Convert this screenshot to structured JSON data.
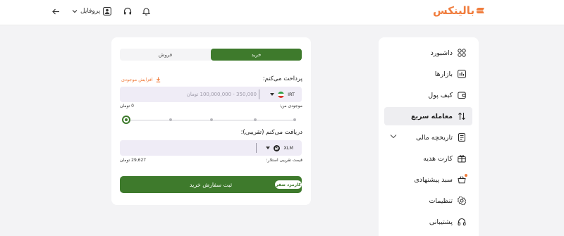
{
  "header": {
    "logo_text": "بالینکس",
    "profile_label": "پروفایل",
    "icons": [
      "bell-icon",
      "headset-icon",
      "user-icon",
      "chevron-down-icon",
      "arrow-left-icon"
    ]
  },
  "sidebar": {
    "items": [
      {
        "label": "داشبورد",
        "icon": "dashboard-icon"
      },
      {
        "label": "بازارها",
        "icon": "market-icon"
      },
      {
        "label": "کیف پول",
        "icon": "wallet-icon"
      },
      {
        "label": "معامله سریع",
        "icon": "swap-icon",
        "active": true
      },
      {
        "label": "تاریخچه مالی",
        "icon": "history-icon"
      },
      {
        "label": "کارت هدیه",
        "icon": "gift-card-icon"
      },
      {
        "label": "سبد پیشنهادی",
        "icon": "basket-icon"
      },
      {
        "label": "تنظیمات",
        "icon": "settings-icon"
      },
      {
        "label": "پشتیبانی",
        "icon": "support-icon"
      }
    ]
  },
  "trade": {
    "tab_buy": "خرید",
    "tab_sell": "فروش",
    "pay_label": "پرداخت می‌کنم:",
    "increase_balance": "افزایش موجودی",
    "pay_currency": "IRT",
    "pay_placeholder": "350,000 - 100,000,000 تومان",
    "balance_label": "موجودی من:",
    "balance_value": "0 تومان",
    "slider_percent": 0,
    "receive_label": "دریافت می‌کنم (تقریبی):",
    "receive_currency": "XLM",
    "price_label": "قیمت تقریبی استلار:",
    "price_value": "29,627 تومان",
    "submit_label": "ثبت سفارش خرید",
    "fee_badge": "کارمزد صفر"
  },
  "colors": {
    "accent": "#3e7a2c",
    "brand": "#f07c3c",
    "field_bg": "#efecf6"
  }
}
